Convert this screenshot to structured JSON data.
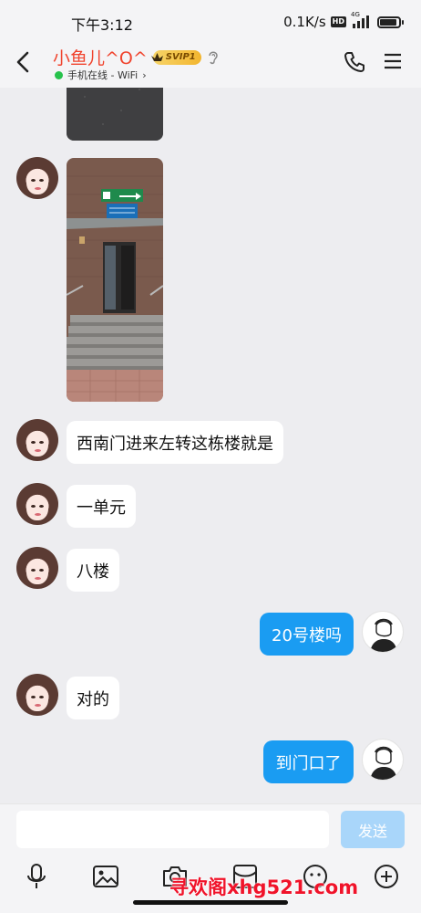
{
  "status_bar": {
    "time": "下午3:12",
    "net_speed": "0.1K/s",
    "hd": "HD",
    "network": "4G"
  },
  "header": {
    "contact_name": "小鱼儿^O^",
    "vip_badge": "SVIP1",
    "online_status": "手机在线 - WiFi",
    "online_chevron": "›"
  },
  "messages": [
    {
      "side": "left",
      "type": "image",
      "desc": "road"
    },
    {
      "side": "left",
      "type": "image",
      "desc": "building"
    },
    {
      "side": "left",
      "type": "text",
      "text": "西南门进来左转这栋楼就是"
    },
    {
      "side": "left",
      "type": "text",
      "text": "一单元"
    },
    {
      "side": "left",
      "type": "text",
      "text": "八楼"
    },
    {
      "side": "right",
      "type": "text",
      "text": "20号楼吗"
    },
    {
      "side": "left",
      "type": "text",
      "text": "对的"
    },
    {
      "side": "right",
      "type": "text",
      "text": "到门口了"
    }
  ],
  "input_bar": {
    "input_value": "",
    "send_label": "发送",
    "tools": [
      "microphone-icon",
      "image-icon",
      "camera-icon",
      "red-packet-icon",
      "emoji-icon",
      "plus-icon"
    ]
  },
  "watermark": "寻欢阁xhg521.com",
  "colors": {
    "sent_bubble": "#1a9cf2",
    "name": "#f0442e",
    "online": "#27c24c",
    "send_button": "#a9d6fa"
  }
}
